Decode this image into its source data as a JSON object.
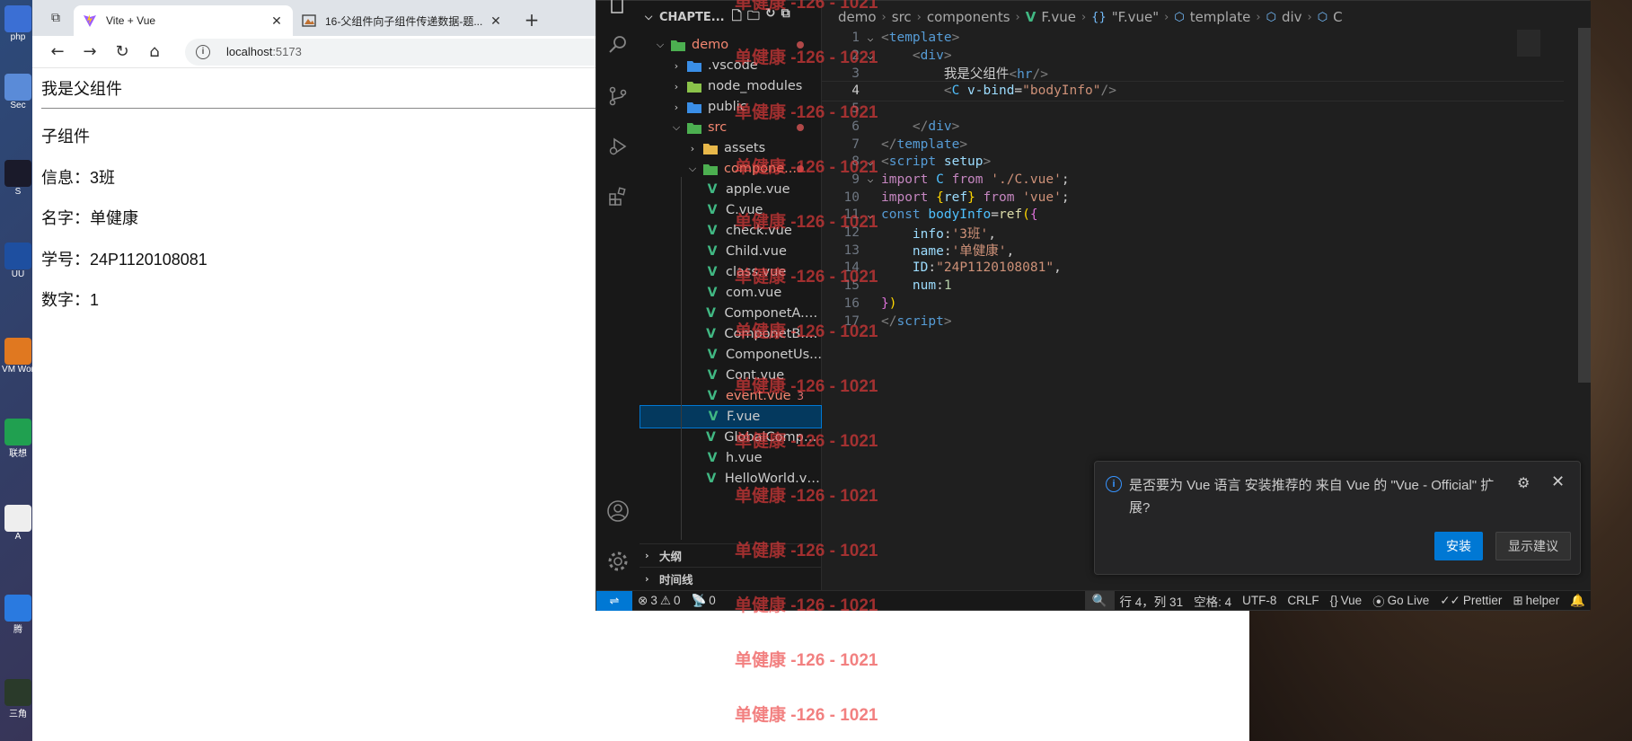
{
  "desktop": {
    "icons": [
      "php",
      "Sec",
      "S",
      "UU",
      "VM Wor",
      "联想",
      "A",
      "腾",
      "三角"
    ]
  },
  "browser": {
    "tabs": [
      {
        "title": "Vite + Vue",
        "active": true
      },
      {
        "title": "16-父组件向子组件传递数据-题...",
        "active": false
      }
    ],
    "url_host": "localhost",
    "url_port": ":5173",
    "page": {
      "heading": "我是父组件",
      "child_title": "子组件",
      "lines": [
        "信息：3班",
        "名字：单健康",
        "学号：24P1120108081",
        "数字：1"
      ]
    }
  },
  "vscode": {
    "explorer_title": "CHAPTE...",
    "tree": [
      {
        "name": "demo",
        "kind": "folder-open",
        "depth": 0,
        "color": "red",
        "dot": true
      },
      {
        "name": ".vscode",
        "kind": "folder",
        "depth": 1,
        "color": "white"
      },
      {
        "name": "node_modules",
        "kind": "folder",
        "depth": 1,
        "color": "white"
      },
      {
        "name": "public",
        "kind": "folder",
        "depth": 1,
        "color": "white"
      },
      {
        "name": "src",
        "kind": "folder-open",
        "depth": 1,
        "color": "red",
        "dot": true
      },
      {
        "name": "assets",
        "kind": "folder",
        "depth": 2,
        "color": "white"
      },
      {
        "name": "compone...",
        "kind": "folder-open",
        "depth": 2,
        "color": "red",
        "dot": true
      },
      {
        "name": "apple.vue",
        "kind": "vue",
        "depth": 3,
        "color": "white"
      },
      {
        "name": "C.vue",
        "kind": "vue",
        "depth": 3,
        "color": "white"
      },
      {
        "name": "check.vue",
        "kind": "vue",
        "depth": 3,
        "color": "white"
      },
      {
        "name": "Child.vue",
        "kind": "vue",
        "depth": 3,
        "color": "white"
      },
      {
        "name": "class.vue",
        "kind": "vue",
        "depth": 3,
        "color": "white"
      },
      {
        "name": "com.vue",
        "kind": "vue",
        "depth": 3,
        "color": "white"
      },
      {
        "name": "ComponetA.v...",
        "kind": "vue",
        "depth": 3,
        "color": "white"
      },
      {
        "name": "ComponetB.v...",
        "kind": "vue",
        "depth": 3,
        "color": "white"
      },
      {
        "name": "ComponetUs...",
        "kind": "vue",
        "depth": 3,
        "color": "white"
      },
      {
        "name": "Cont.vue",
        "kind": "vue",
        "depth": 3,
        "color": "white"
      },
      {
        "name": "event.vue",
        "kind": "vue",
        "depth": 3,
        "color": "red",
        "badge": "3"
      },
      {
        "name": "F.vue",
        "kind": "vue",
        "depth": 3,
        "color": "white",
        "selected": true
      },
      {
        "name": "GlobalCompo...",
        "kind": "vue",
        "depth": 3,
        "color": "white"
      },
      {
        "name": "h.vue",
        "kind": "vue",
        "depth": 3,
        "color": "white"
      },
      {
        "name": "HelloWorld.vue",
        "kind": "vue",
        "depth": 3,
        "color": "white"
      }
    ],
    "sections": [
      "大纲",
      "时间线"
    ],
    "breadcrumbs": {
      "parts": [
        "demo",
        "src",
        "components"
      ],
      "file": "F.vue",
      "symbol1": "\"F.vue\"",
      "symbol2": "template",
      "symbol3": "div",
      "symbol4": "C"
    },
    "code_lines": [
      {
        "n": "1",
        "fold": true,
        "tokens": [
          [
            "tk-punc",
            "<"
          ],
          [
            "tk-tag",
            "template"
          ],
          [
            "tk-punc",
            ">"
          ]
        ]
      },
      {
        "n": "2",
        "fold": true,
        "tokens": [
          [
            "",
            "    "
          ],
          [
            "tk-punc",
            "<"
          ],
          [
            "tk-tag",
            "div"
          ],
          [
            "tk-punc",
            ">"
          ]
        ]
      },
      {
        "n": "3",
        "fold": false,
        "tokens": [
          [
            "",
            "        我是父组件"
          ],
          [
            "tk-punc",
            "<"
          ],
          [
            "tk-tag",
            "hr"
          ],
          [
            "tk-punc",
            "/>"
          ]
        ]
      },
      {
        "n": "4",
        "fold": false,
        "cur": true,
        "tokens": [
          [
            "",
            "        "
          ],
          [
            "tk-punc",
            "<"
          ],
          [
            "tk-var",
            "C"
          ],
          [
            "",
            ""
          ],
          [
            "tk-attr",
            " v-bind"
          ],
          [
            "",
            "="
          ],
          [
            "tk-str",
            "\"bodyInfo\""
          ],
          [
            "tk-punc",
            "/>"
          ]
        ]
      },
      {
        "n": "5",
        "fold": false,
        "tokens": [
          [
            "",
            ""
          ]
        ]
      },
      {
        "n": "6",
        "fold": false,
        "tokens": [
          [
            "",
            "    "
          ],
          [
            "tk-punc",
            "</"
          ],
          [
            "tk-tag",
            "div"
          ],
          [
            "tk-punc",
            ">"
          ]
        ]
      },
      {
        "n": "7",
        "fold": false,
        "tokens": [
          [
            "tk-punc",
            "</"
          ],
          [
            "tk-tag",
            "template"
          ],
          [
            "tk-punc",
            ">"
          ]
        ]
      },
      {
        "n": "8",
        "fold": true,
        "tokens": [
          [
            "tk-punc",
            "<"
          ],
          [
            "tk-tag",
            "script"
          ],
          [
            "tk-attr",
            " setup"
          ],
          [
            "tk-punc",
            ">"
          ]
        ]
      },
      {
        "n": "9",
        "fold": true,
        "tokens": [
          [
            "tk-key",
            "import"
          ],
          [
            "",
            " "
          ],
          [
            "tk-var",
            "C"
          ],
          [
            "",
            " "
          ],
          [
            "tk-key",
            "from"
          ],
          [
            "",
            " "
          ],
          [
            "tk-str",
            "'./C.vue'"
          ],
          [
            "",
            ";"
          ]
        ]
      },
      {
        "n": "10",
        "fold": false,
        "tokens": [
          [
            "tk-key",
            "import"
          ],
          [
            "",
            " "
          ],
          [
            "tk-br",
            "{"
          ],
          [
            "tk-obj",
            "ref"
          ],
          [
            "tk-br",
            "}"
          ],
          [
            "",
            " "
          ],
          [
            "tk-key",
            "from"
          ],
          [
            "",
            " "
          ],
          [
            "tk-str",
            "'vue'"
          ],
          [
            "",
            ";"
          ]
        ]
      },
      {
        "n": "11",
        "fold": true,
        "tokens": [
          [
            "tk-kw",
            "const"
          ],
          [
            "",
            " "
          ],
          [
            "tk-var",
            "bodyInfo"
          ],
          [
            "",
            "="
          ],
          [
            "tk-fn",
            "ref"
          ],
          [
            "tk-br",
            "("
          ],
          [
            "tk-br2",
            "{"
          ]
        ]
      },
      {
        "n": "12",
        "fold": false,
        "tokens": [
          [
            "",
            "    "
          ],
          [
            "tk-obj",
            "info"
          ],
          [
            "",
            ":"
          ],
          [
            "tk-str",
            "'3班'"
          ],
          [
            "",
            ","
          ]
        ]
      },
      {
        "n": "13",
        "fold": false,
        "tokens": [
          [
            "",
            "    "
          ],
          [
            "tk-obj",
            "name"
          ],
          [
            "",
            ":"
          ],
          [
            "tk-str",
            "'单健康'"
          ],
          [
            "",
            ","
          ]
        ]
      },
      {
        "n": "14",
        "fold": false,
        "tokens": [
          [
            "",
            "    "
          ],
          [
            "tk-obj",
            "ID"
          ],
          [
            "",
            ":"
          ],
          [
            "tk-str",
            "\"24P1120108081\""
          ],
          [
            "",
            ","
          ]
        ]
      },
      {
        "n": "15",
        "fold": false,
        "tokens": [
          [
            "",
            "    "
          ],
          [
            "tk-obj",
            "num"
          ],
          [
            "",
            ":"
          ],
          [
            "tk-num",
            "1"
          ]
        ]
      },
      {
        "n": "16",
        "fold": false,
        "tokens": [
          [
            "tk-br2",
            "}"
          ],
          [
            "tk-br",
            ")"
          ]
        ]
      },
      {
        "n": "17",
        "fold": false,
        "tokens": [
          [
            "tk-punc",
            "</"
          ],
          [
            "tk-tag",
            "script"
          ],
          [
            "tk-punc",
            ">"
          ]
        ]
      }
    ],
    "notification": {
      "message": "是否要为 Vue 语言 安装推荐的 来自 Vue 的 \"Vue - Official\" 扩展?",
      "install_label": "安装",
      "show_label": "显示建议"
    },
    "status": {
      "errors": "3",
      "warnings": "0",
      "ports": "0",
      "position": "行 4，列 31",
      "spaces": "空格: 4",
      "encoding": "UTF-8",
      "eol": "CRLF",
      "language": "Vue",
      "golive": "Go Live",
      "prettier": "Prettier",
      "helper": "helper"
    }
  },
  "watermark": {
    "text": "单健康 -126 - 1021",
    "color": "#eb3c3c"
  }
}
